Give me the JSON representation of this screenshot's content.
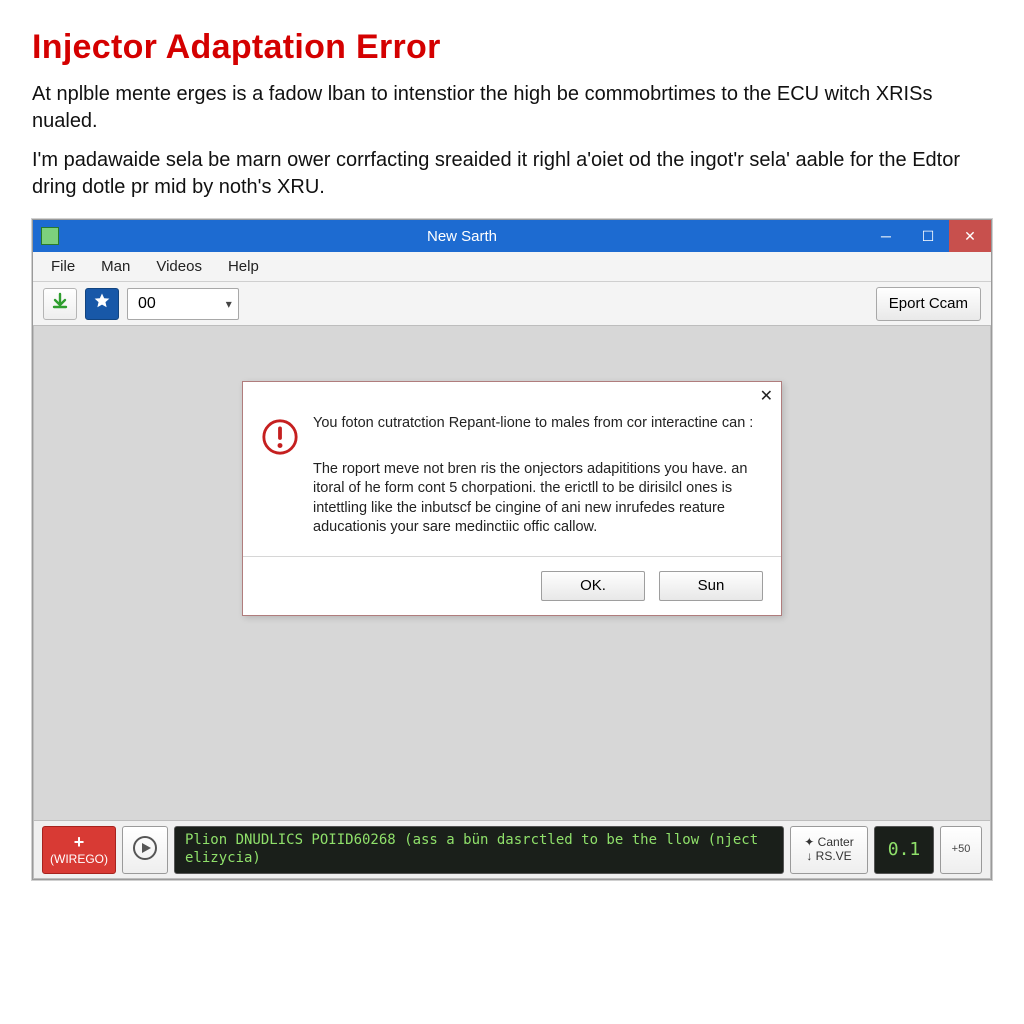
{
  "page": {
    "heading": "Injector Adaptation Error",
    "para1": "At nplble mente erges is a fadow lban to intenstior the high be commobrtimes to the ECU witch XRISs nualed.",
    "para2": "I'm padawaide sela be marn ower corrfacting sreaided it righl a'oiet od the ingot'r sela' aable for the Edtor dring dotle pr mid by noth's XRU."
  },
  "window": {
    "title": "New Sarth",
    "menus": [
      "File",
      "Man",
      "Videos",
      "Help"
    ],
    "toolbar": {
      "combo_value": "00",
      "export_label": "Eport Ccam"
    }
  },
  "dialog": {
    "main_text": "You foton cutratction Repant-lione to males from cor interactine can :",
    "detail_text": "The roport meve not bren ris the onjectors adapititions you have. an itoral of he form cont 5 chorpationi. the erictll to be dirisilcl ones is intettling like the inbutscf be cingine of ani new inrufedes reature aducationis your sare medinctiic offic callow.",
    "ok_label": "OK.",
    "sun_label": "Sun"
  },
  "statusbar": {
    "red_label": "(WIREGO)",
    "terminal_text": "Plion DNUDLICS POIID60268 (ass a bün dasrctled to be the llow (nject elizycia)",
    "canter_top": "✦ Canter",
    "canter_bottom": "↓ RS.VE",
    "counter": "0.1",
    "tail": "+50"
  }
}
